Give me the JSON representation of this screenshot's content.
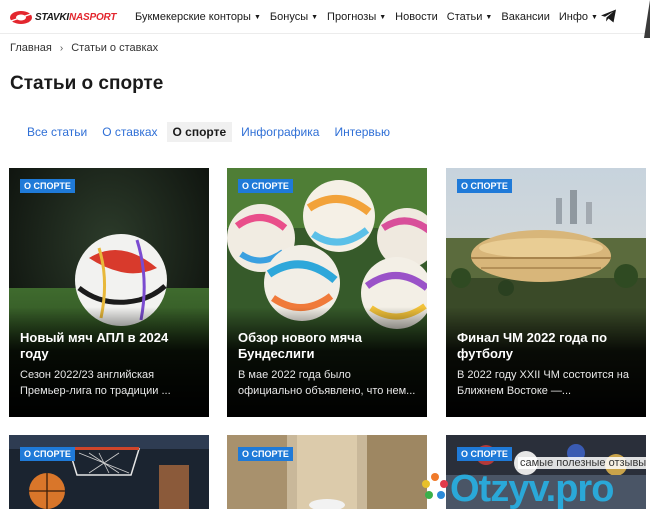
{
  "header": {
    "logo": {
      "part1": "STAVKI",
      "part2": "NASPORT"
    },
    "nav": [
      {
        "label": "Букмекерские конторы",
        "caret": "▼"
      },
      {
        "label": "Бонусы",
        "caret": "▼"
      },
      {
        "label": "Прогнозы",
        "caret": "▼"
      },
      {
        "label": "Новости",
        "caret": ""
      },
      {
        "label": "Статьи",
        "caret": "▼"
      },
      {
        "label": "Вакансии",
        "caret": ""
      },
      {
        "label": "Инфо",
        "caret": "▼"
      }
    ],
    "telegram_icon": "telegram-icon"
  },
  "breadcrumb": {
    "home": "Главная",
    "separator": "›",
    "current": "Статьи о ставках"
  },
  "page_title": "Статьи о спорте",
  "tabs": [
    {
      "label": "Все статьи",
      "active": false
    },
    {
      "label": "О ставках",
      "active": false
    },
    {
      "label": "О спорте",
      "active": true
    },
    {
      "label": "Инфографика",
      "active": false
    },
    {
      "label": "Интервью",
      "active": false
    }
  ],
  "cards": [
    {
      "badge": "О СПОРТЕ",
      "title": "Новый мяч АПЛ в 2024 году",
      "text": "Сезон 2022/23 английская Премьер-лига по традиции ..."
    },
    {
      "badge": "О СПОРТЕ",
      "title": "Обзор нового мяча Бундеслиги",
      "text": "В мае 2022 года было официально объявлено, что нем..."
    },
    {
      "badge": "О СПОРТЕ",
      "title": "Финал ЧМ 2022 года по футболу",
      "text": "В 2022 году XXII ЧМ состоится на Ближнем Востоке —..."
    },
    {
      "badge": "О СПОРТЕ",
      "title": "",
      "text": ""
    },
    {
      "badge": "О СПОРТЕ",
      "title": "",
      "text": ""
    },
    {
      "badge": "О СПОРТЕ",
      "title": "",
      "text": ""
    }
  ],
  "watermark": {
    "tagline": "самые полезные отзывы",
    "brand": "Otzyv.pro"
  },
  "colors": {
    "accent": "#2f6fd6",
    "badge": "#1f7ad8",
    "logo_red": "#e3262e"
  }
}
